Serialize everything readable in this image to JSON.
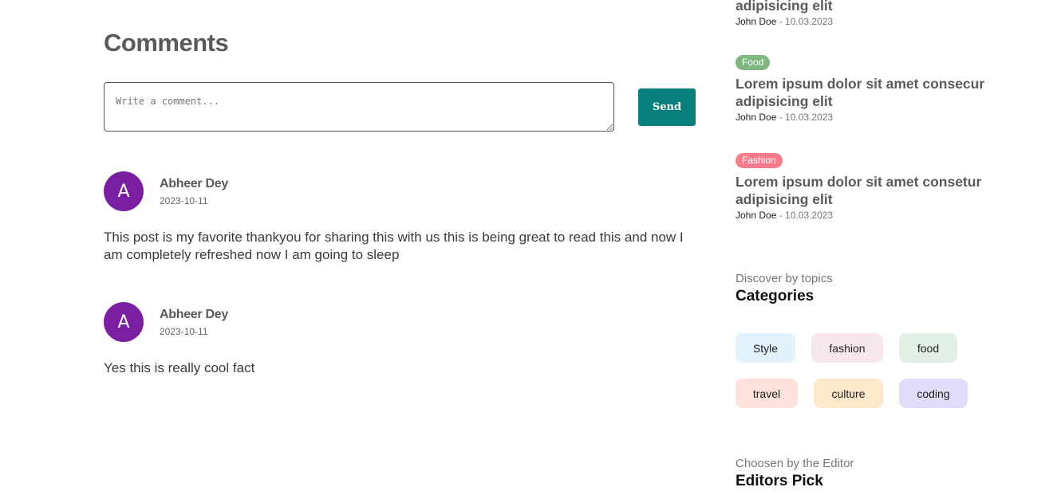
{
  "comments_section": {
    "title": "Comments",
    "input_placeholder": "Write a comment...",
    "send_label": "Send",
    "items": [
      {
        "avatar_letter": "A",
        "author": "Abheer Dey",
        "date": "2023-10-11",
        "text": "This post is my favorite thankyou for sharing this with us this is being great to read this and now I am completely refreshed now I am going to sleep"
      },
      {
        "avatar_letter": "A",
        "author": "Abheer Dey",
        "date": "2023-10-11",
        "text": "Yes this is really cool fact"
      }
    ]
  },
  "popular_posts": [
    {
      "title": "adipisicing elit",
      "author": "John Doe",
      "date": "10.03.2023"
    },
    {
      "tag": "Food",
      "title": "Lorem ipsum dolor sit amet consecur adipisicing elit",
      "author": "John Doe",
      "date": "10.03.2023"
    },
    {
      "tag": "Fashion",
      "title": "Lorem ipsum dolor sit amet consetur adipisicing elit",
      "author": "John Doe",
      "date": "10.03.2023"
    }
  ],
  "categories": {
    "subtitle": "Discover by topics",
    "title": "Categories",
    "items": [
      {
        "label": "Style",
        "color": "#e1f2fd"
      },
      {
        "label": "fashion",
        "color": "#f8e6ef"
      },
      {
        "label": "food",
        "color": "#e2efe4"
      },
      {
        "label": "travel",
        "color": "#fde2dc"
      },
      {
        "label": "culture",
        "color": "#fde8cc"
      },
      {
        "label": "coding",
        "color": "#e1dcfa"
      }
    ]
  },
  "editors_pick": {
    "subtitle": "Choosen by the Editor",
    "title": "Editors Pick"
  },
  "colors": {
    "accent": "#087f7c",
    "avatar": "#7b1fa2",
    "tag_food": "#7fb77e",
    "tag_fashion": "#f57c8c"
  }
}
